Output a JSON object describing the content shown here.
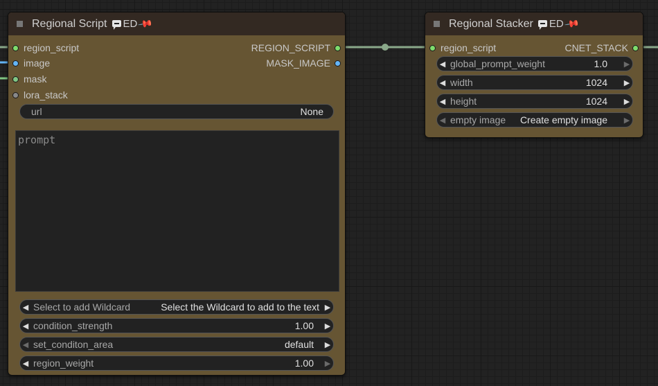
{
  "nodes": {
    "regional_script": {
      "title": "Regional Script",
      "badge": "ED",
      "inputs": [
        {
          "label": "region_script",
          "color": "#7edc6c"
        },
        {
          "label": "image",
          "color": "#64b5f6"
        },
        {
          "label": "mask",
          "color": "#81c784"
        },
        {
          "label": "lora_stack",
          "color": "#888888"
        }
      ],
      "outputs": [
        {
          "label": "REGION_SCRIPT",
          "color": "#7edc6c"
        },
        {
          "label": "MASK_IMAGE",
          "color": "#64b5f6"
        }
      ],
      "url": {
        "label": "url",
        "value": "None"
      },
      "prompt_placeholder": "prompt",
      "widgets": [
        {
          "label": "Select to add Wildcard",
          "value": "Select the Wildcard to add to the text"
        },
        {
          "label": "condition_strength",
          "value": "1.00"
        },
        {
          "label": "set_conditon_area",
          "value": "default"
        },
        {
          "label": "region_weight",
          "value": "1.00"
        }
      ]
    },
    "regional_stacker": {
      "title": "Regional Stacker",
      "badge": "ED",
      "inputs": [
        {
          "label": "region_script",
          "color": "#7edc6c"
        }
      ],
      "outputs": [
        {
          "label": "CNET_STACK",
          "color": "#7edc6c"
        }
      ],
      "widgets": [
        {
          "label": "global_prompt_weight",
          "value": "1.0"
        },
        {
          "label": "width",
          "value": "1024"
        },
        {
          "label": "height",
          "value": "1024"
        },
        {
          "label": "empty image",
          "value": "Create empty image"
        }
      ]
    }
  },
  "link_colors": {
    "region_script": "#8aa88a",
    "image": "#64b5f6",
    "mask": "#81c784"
  }
}
